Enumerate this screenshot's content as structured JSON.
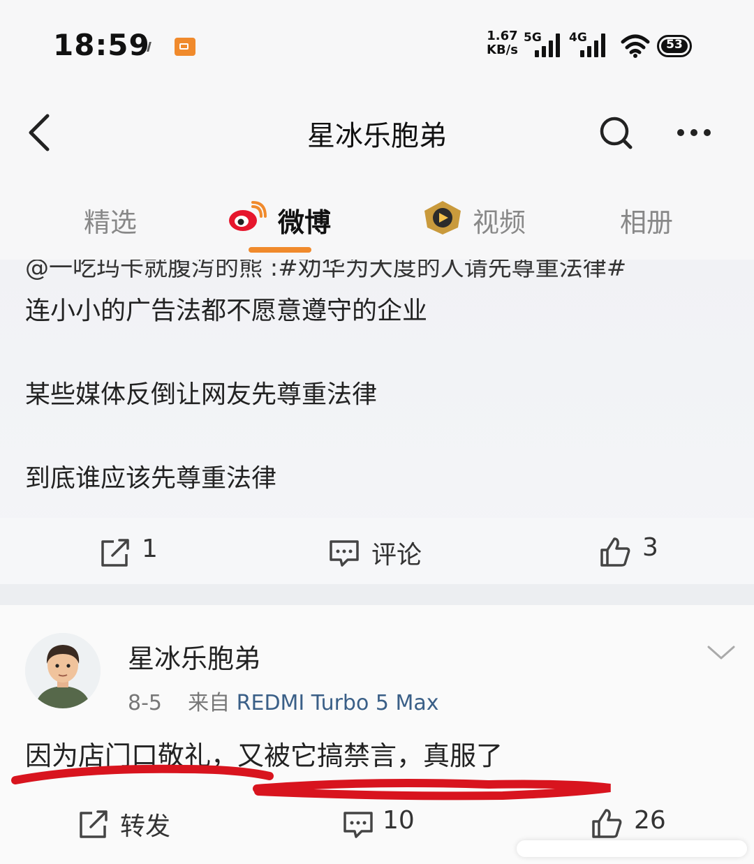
{
  "status_bar": {
    "time": "18:59",
    "net_speed_value": "1.67",
    "net_speed_unit": "KB/s",
    "signal1_label": "5G",
    "signal2_label": "4G",
    "battery": "53"
  },
  "nav": {
    "title": "星冰乐胞弟",
    "back_icon": "back-arrow-icon",
    "search_icon": "search-icon",
    "more_icon": "more-icon"
  },
  "tabs": [
    {
      "label": "精选"
    },
    {
      "label": "微博"
    },
    {
      "label": "视频"
    },
    {
      "label": "相册"
    }
  ],
  "post1": {
    "cut_line": "@一吃玛卡就腹泻的熊 :#劝华为大度的人请先尊重法律#",
    "lines": [
      "连小小的广告法都不愿意遵守的企业",
      "某些媒体反倒让网友先尊重法律",
      "到底谁应该先尊重法律"
    ],
    "repost_count": "1",
    "comment_label": "评论",
    "like_count": "3"
  },
  "post2": {
    "author": "星冰乐胞弟",
    "date": "8-5",
    "source_prefix": "来自",
    "source": "REDMI Turbo 5 Max",
    "text": "因为店门口敬礼，又被它搞禁言，真服了",
    "repost_label": "转发",
    "comment_count": "10",
    "like_count": "26"
  },
  "colors": {
    "accent": "#f08a2c",
    "weibo_red": "#e6162d",
    "link_blue": "#3a5f87",
    "annotation_red": "#d8141e"
  }
}
